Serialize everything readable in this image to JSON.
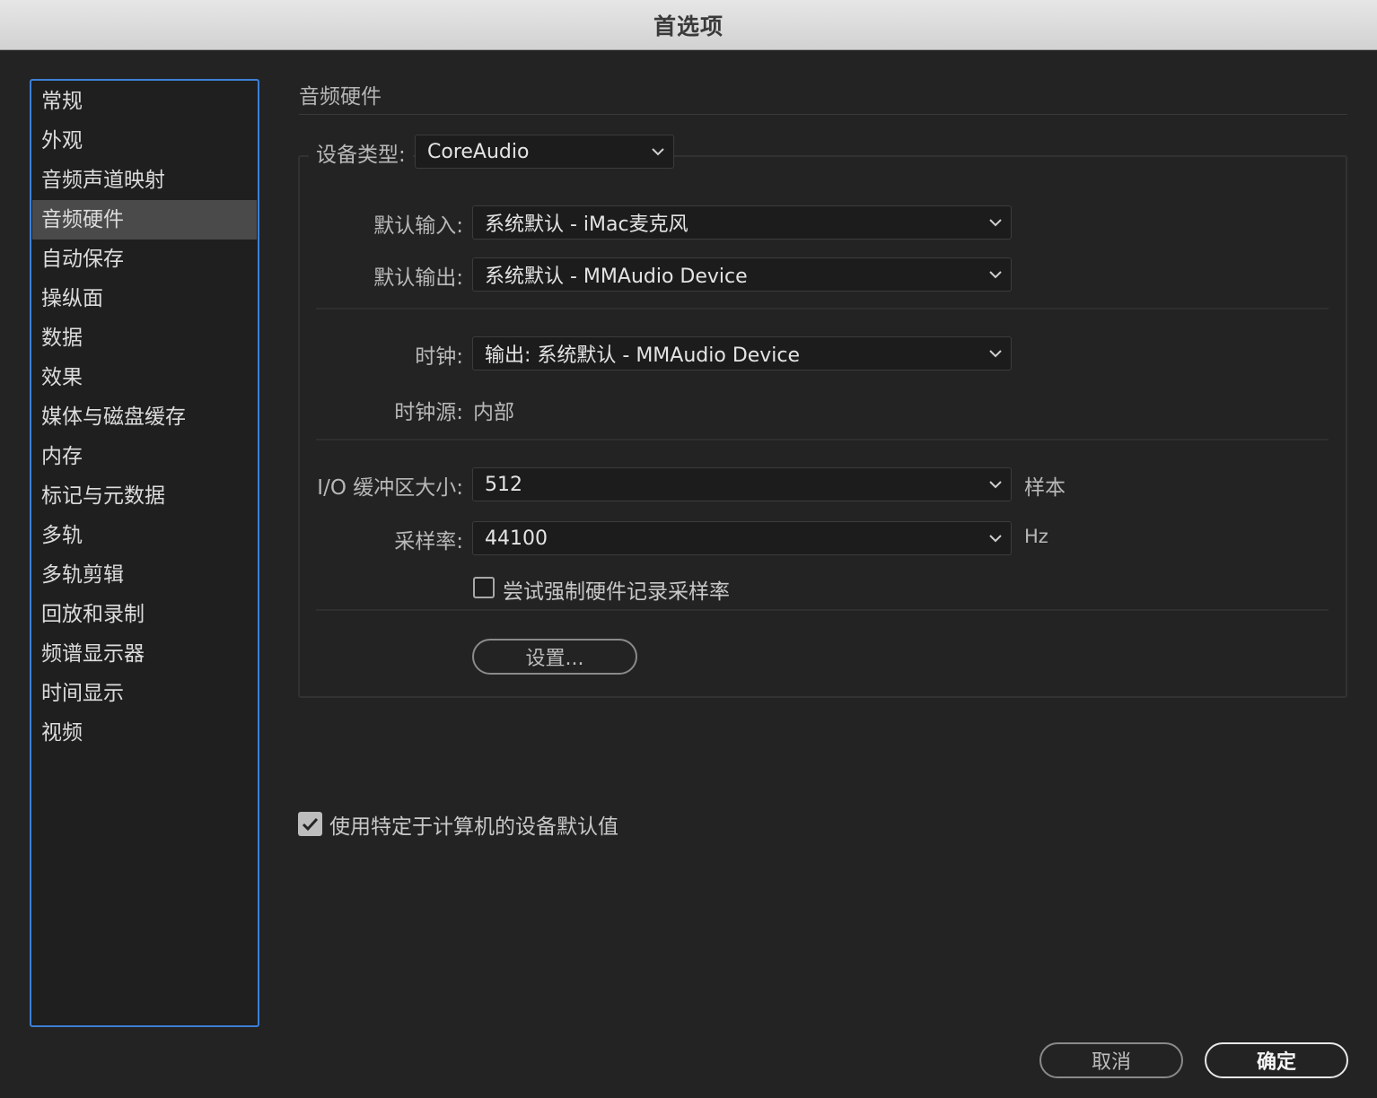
{
  "window": {
    "title": "首选项"
  },
  "sidebar": {
    "items": [
      {
        "label": "常规",
        "selected": false
      },
      {
        "label": "外观",
        "selected": false
      },
      {
        "label": "音频声道映射",
        "selected": false
      },
      {
        "label": "音频硬件",
        "selected": true
      },
      {
        "label": "自动保存",
        "selected": false
      },
      {
        "label": "操纵面",
        "selected": false
      },
      {
        "label": "数据",
        "selected": false
      },
      {
        "label": "效果",
        "selected": false
      },
      {
        "label": "媒体与磁盘缓存",
        "selected": false
      },
      {
        "label": "内存",
        "selected": false
      },
      {
        "label": "标记与元数据",
        "selected": false
      },
      {
        "label": "多轨",
        "selected": false
      },
      {
        "label": "多轨剪辑",
        "selected": false
      },
      {
        "label": "回放和录制",
        "selected": false
      },
      {
        "label": "频谱显示器",
        "selected": false
      },
      {
        "label": "时间显示",
        "selected": false
      },
      {
        "label": "视频",
        "selected": false
      }
    ]
  },
  "main": {
    "heading": "音频硬件",
    "device_type": {
      "label": "设备类型:",
      "value": "CoreAudio"
    },
    "default_input": {
      "label": "默认输入:",
      "value": "系统默认 - iMac麦克风"
    },
    "default_output": {
      "label": "默认输出:",
      "value": "系统默认 - MMAudio Device"
    },
    "clock": {
      "label": "时钟:",
      "value": "输出: 系统默认 - MMAudio Device"
    },
    "clock_source": {
      "label": "时钟源:",
      "value": "内部"
    },
    "io_buffer": {
      "label": "I/O 缓冲区大小:",
      "value": "512",
      "unit": "样本"
    },
    "sample_rate": {
      "label": "采样率:",
      "value": "44100",
      "unit": "Hz"
    },
    "force_sample_rate": {
      "label": "尝试强制硬件记录采样率",
      "checked": false
    },
    "settings_button": "设置...",
    "use_machine_defaults": {
      "label": "使用特定于计算机的设备默认值",
      "checked": true
    }
  },
  "footer": {
    "cancel_label": "取消",
    "ok_label": "确定"
  },
  "colors": {
    "background": "#232323",
    "sidebar_focus_border": "#3d7fd6",
    "selected_item": "#4a4a4a",
    "titlebar": "#dcdcdc"
  },
  "icons": {
    "dropdown": "chevron-down-icon",
    "checkbox": "checkmark-icon"
  }
}
